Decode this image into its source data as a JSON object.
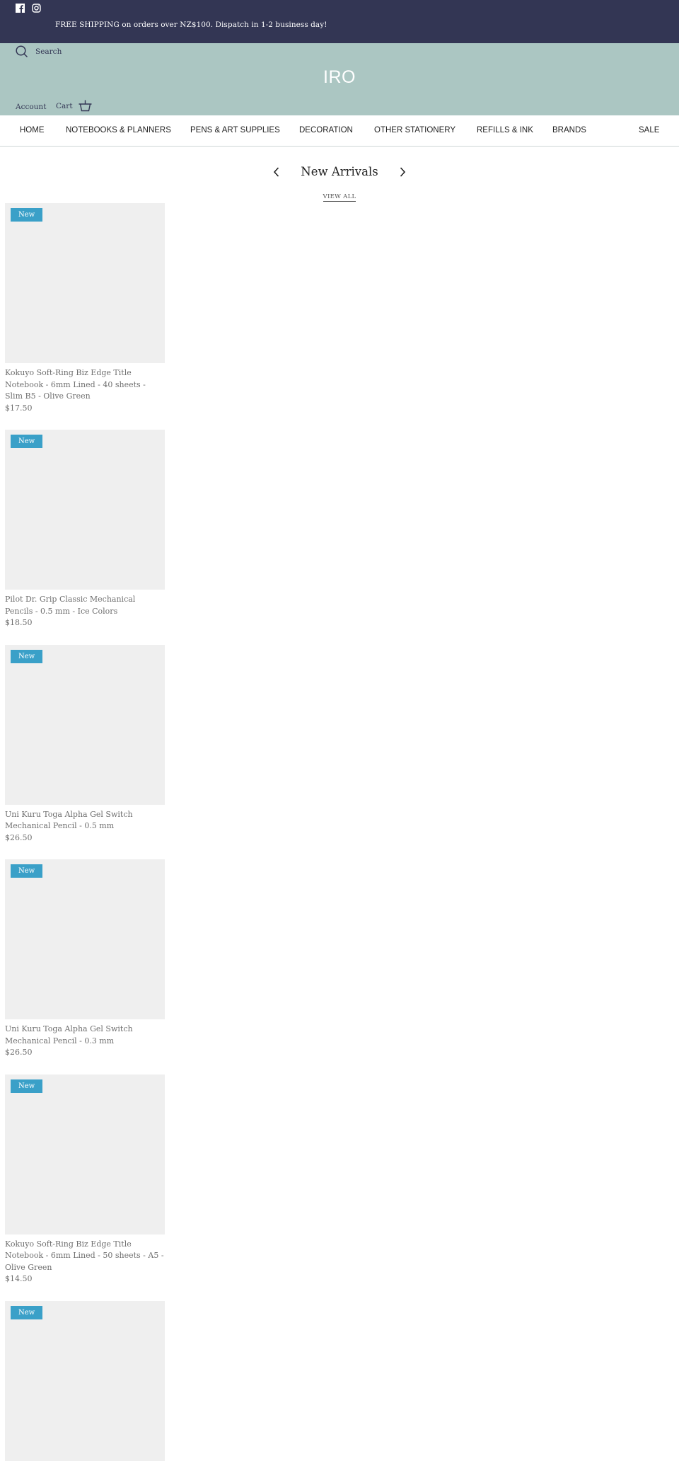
{
  "topbar": {
    "social": [
      {
        "name": "facebook-icon",
        "label": "Facebook"
      },
      {
        "name": "instagram-icon",
        "label": "Instagram"
      }
    ],
    "announcement": "FREE SHIPPING on orders over NZ$100. Dispatch in 1-2 business day!"
  },
  "header": {
    "search_label": "Search",
    "logo": "IRO",
    "account_label": "Account",
    "cart_label": "Cart"
  },
  "nav": {
    "items": [
      {
        "label": "HOME"
      },
      {
        "label": "NOTEBOOKS & PLANNERS"
      },
      {
        "label": "PENS & ART SUPPLIES"
      },
      {
        "label": "DECORATION"
      },
      {
        "label": "OTHER STATIONERY"
      },
      {
        "label": "REFILLS & INK"
      },
      {
        "label": "BRANDS"
      },
      {
        "label": "SALE"
      }
    ]
  },
  "section": {
    "title": "New Arrivals",
    "view_all": "VIEW ALL"
  },
  "products": [
    {
      "badge": "New",
      "title": "Kokuyo Soft-Ring Biz Edge Title Notebook - 6mm Lined - 40 sheets - Slim B5 - Olive Green",
      "price": "$17.50"
    },
    {
      "badge": "New",
      "title": "Pilot Dr. Grip Classic Mechanical Pencils - 0.5 mm - Ice Colors",
      "price": "$18.50"
    },
    {
      "badge": "New",
      "title": "Uni Kuru Toga Alpha Gel Switch Mechanical Pencil - 0.5 mm",
      "price": "$26.50"
    },
    {
      "badge": "New",
      "title": "Uni Kuru Toga Alpha Gel Switch Mechanical Pencil - 0.3 mm",
      "price": "$26.50"
    },
    {
      "badge": "New",
      "title": "Kokuyo Soft-Ring Biz Edge Title Notebook - 6mm Lined - 50 sheets - A5 - Olive Green",
      "price": "$14.50"
    },
    {
      "badge": "New",
      "title": "",
      "price": ""
    }
  ],
  "colors": {
    "topbar_bg": "#333654",
    "header_bg": "#abc6c2",
    "badge_bg": "#3aa0c8",
    "image_placeholder": "#efefef"
  }
}
